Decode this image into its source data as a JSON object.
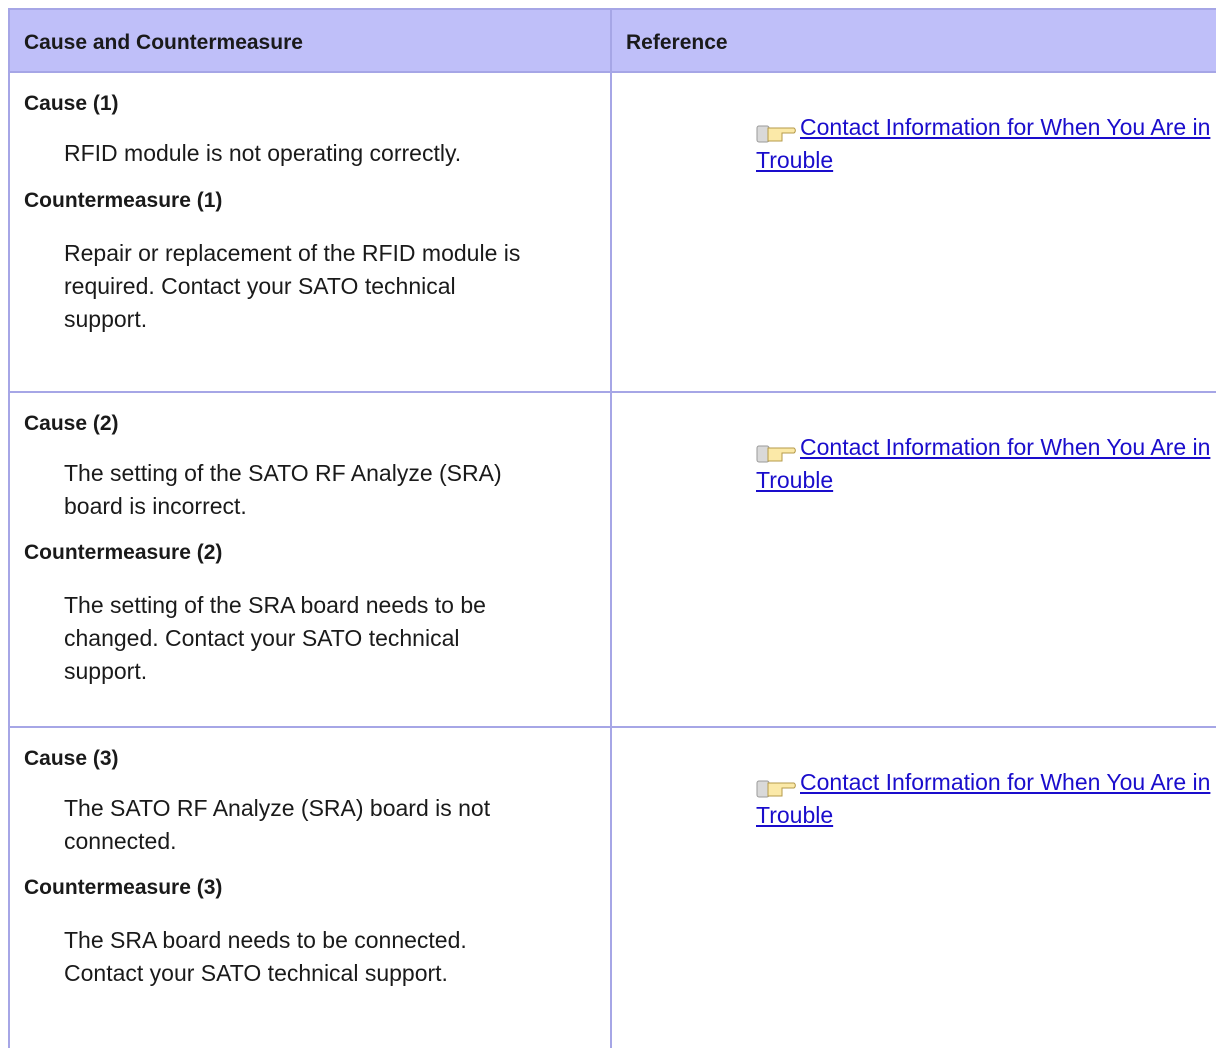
{
  "header": {
    "col1": "Cause and Countermeasure",
    "col2": "Reference"
  },
  "rows": [
    {
      "cause_title": "Cause (1)",
      "cause_text": "RFID module is not operating correctly.",
      "cm_title": "Countermeasure (1)",
      "cm_text": "Repair or replacement of the RFID module is required. Contact your SATO technical support.",
      "reference_link": "Contact Information for When You Are in Trouble"
    },
    {
      "cause_title": "Cause (2)",
      "cause_text": "The setting of the SATO RF Analyze (SRA) board is incorrect.",
      "cm_title": "Countermeasure (2)",
      "cm_text": "The setting of the SRA board needs to be changed. Contact your SATO technical support.",
      "reference_link": "Contact Information for When You Are in Trouble"
    },
    {
      "cause_title": "Cause (3)",
      "cause_text": "The SATO RF Analyze (SRA) board is not connected.",
      "cm_title": "Countermeasure (3)",
      "cm_text": "The SRA board needs to be connected. Contact your SATO technical support.",
      "reference_link": "Contact Information for When You Are in Trouble"
    }
  ],
  "icons": {
    "reference": "pointing-hand-icon"
  },
  "colors": {
    "header_bg": "#bfbff9",
    "border": "#a6a6e6",
    "link": "#1a0dcc"
  }
}
